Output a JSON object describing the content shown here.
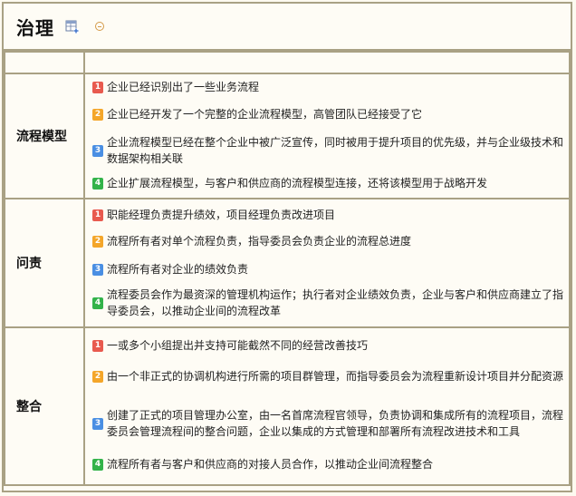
{
  "title": "治理",
  "header": {
    "col1": "",
    "col2": ""
  },
  "sections": [
    {
      "category": "流程模型",
      "items": [
        {
          "level": "1",
          "text": "企业已经识别出了一些业务流程"
        },
        {
          "level": "2",
          "text": "企业已经开发了一个完整的企业流程模型，高管团队已经接受了它"
        },
        {
          "level": "3",
          "text": "企业流程模型已经在整个企业中被广泛宣传，同时被用于提升项目的优先级，并与企业级技术和数据架构相关联"
        },
        {
          "level": "4",
          "text": "企业扩展流程模型，与客户和供应商的流程模型连接，还将该模型用于战略开发"
        }
      ]
    },
    {
      "category": "问责",
      "items": [
        {
          "level": "1",
          "text": "职能经理负责提升绩效，项目经理负责改进项目"
        },
        {
          "level": "2",
          "text": "流程所有者对单个流程负责，指导委员会负责企业的流程总进度"
        },
        {
          "level": "3",
          "text": "流程所有者对企业的绩效负责"
        },
        {
          "level": "4",
          "text": "流程委员会作为最资深的管理机构运作；执行者对企业绩效负责，企业与客户和供应商建立了指导委员会，以推动企业间的流程改革"
        }
      ]
    },
    {
      "category": "整合",
      "items": [
        {
          "level": "1",
          "text": "一或多个小组提出并支持可能截然不同的经营改善技巧"
        },
        {
          "level": "2",
          "text": "由一个非正式的协调机构进行所需的项目群管理，而指导委员会为流程重新设计项目并分配资源"
        },
        {
          "level": "3",
          "text": "创建了正式的项目管理办公室，由一名首席流程官领导，负责协调和集成所有的流程项目，流程委员会管理流程间的整合问题，企业以集成的方式管理和部署所有流程改进技术和工具"
        },
        {
          "level": "4",
          "text": "流程所有者与客户和供应商的对接人员合作，以推动企业间流程整合"
        }
      ]
    }
  ]
}
